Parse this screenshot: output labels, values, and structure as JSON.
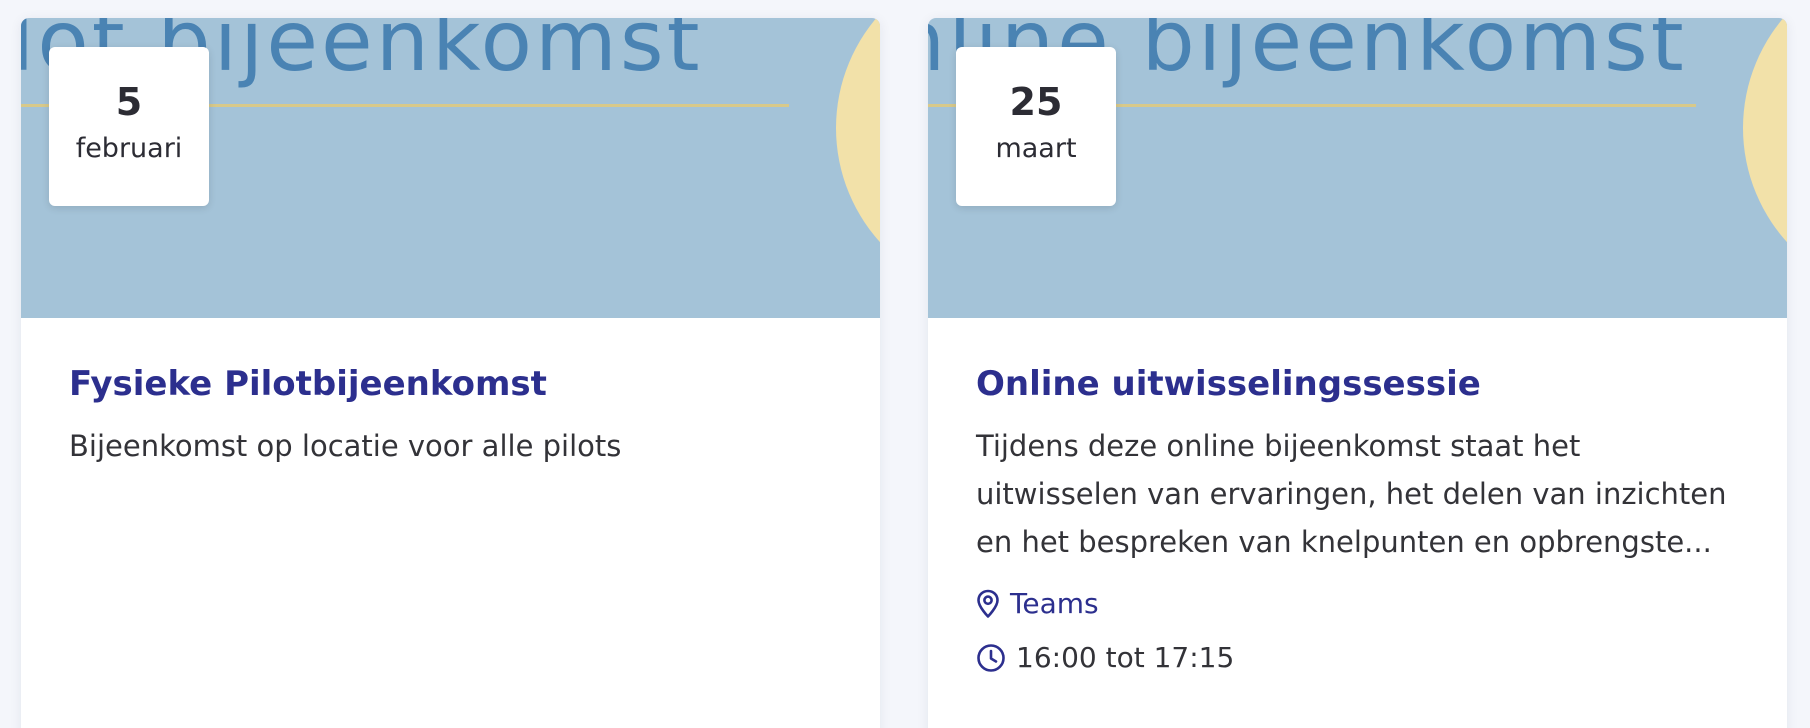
{
  "events": [
    {
      "banner_text": "lot bijeenkomst",
      "date_day": "5",
      "date_month": "februari",
      "title": "Fysieke Pilotbijeenkomst",
      "description_lines": [
        "Bijeenkomst op locatie voor alle pilots"
      ]
    },
    {
      "banner_text": "nline bijeenkomst",
      "date_day": "25",
      "date_month": "maart",
      "title": "Online uitwisselingssessie",
      "description_lines": [
        "Tijdens deze online bijeenkomst staat het",
        "uitwisselen van ervaringen, het delen van inzichten",
        "en het bespreken van knelpunten en opbrengste..."
      ],
      "location_icon": "map-pin-icon",
      "location": "Teams",
      "time_icon": "clock-icon",
      "time": "16:00 tot 17:15"
    }
  ],
  "colors": {
    "title": "#2c2f8e",
    "banner_bg": "#a4c3d8",
    "banner_text": "#4a83b3",
    "banner_accent": "#f2e1a9",
    "body_text": "#333338"
  }
}
